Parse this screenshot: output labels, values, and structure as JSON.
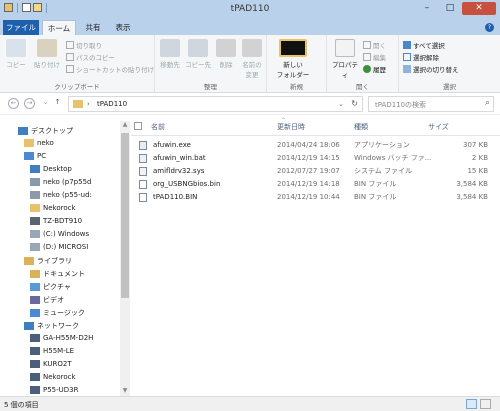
{
  "window": {
    "title": "tPAD110",
    "minimize": "–",
    "maximize": "□",
    "close": "✕"
  },
  "ribbon_tabs": [
    {
      "label": "ファイル"
    },
    {
      "label": "ホーム"
    },
    {
      "label": "共有"
    },
    {
      "label": "表示"
    }
  ],
  "help": "?",
  "ribbon": {
    "clipboard": {
      "copy": "コピー",
      "paste": "貼り付け",
      "cut": "切り取り",
      "copy_path": "パスのコピー",
      "paste_shortcut": "ショートカットの貼り付け",
      "group": "クリップボード"
    },
    "organize": {
      "move_to": "移動先",
      "copy_to": "コピー先",
      "delete": "削除",
      "rename_1": "名前の",
      "rename_2": "変更",
      "group": "整理"
    },
    "new": {
      "new_folder_1": "新しい",
      "new_folder_2": "フォルダー",
      "group": "新規"
    },
    "open": {
      "properties": "プロパティ",
      "open": "開く",
      "edit": "編集",
      "history": "履歴",
      "group": "開く"
    },
    "select": {
      "select_all": "すべて選択",
      "select_none": "選択解除",
      "invert": "選択の切り替え",
      "group": "選択"
    }
  },
  "address": {
    "sep": "›",
    "path": "tPAD110",
    "dropdown": "⌄",
    "refresh": "↻"
  },
  "search": {
    "placeholder": "tPAD110の検索",
    "icon": "⌕"
  },
  "nav": {
    "back": "←",
    "forward": "→",
    "recent": "⌄",
    "up": "↑",
    "items": [
      {
        "label": "デスクトップ",
        "icon": "desktop-icon"
      },
      {
        "label": "neko",
        "icon": "user-folder-icon"
      },
      {
        "label": "PC",
        "icon": "pc-icon"
      },
      {
        "label": "Desktop",
        "icon": "folder-icon"
      },
      {
        "label": "neko (p7p55d",
        "icon": "network-drive-icon"
      },
      {
        "label": "neko (p55-ud:",
        "icon": "network-drive-icon"
      },
      {
        "label": "Nekorock",
        "icon": "folder-icon"
      },
      {
        "label": "TZ-BDT910",
        "icon": "device-icon"
      },
      {
        "label": "(C:) Windows",
        "icon": "drive-icon"
      },
      {
        "label": "(D:) MICROSI",
        "icon": "drive-icon"
      },
      {
        "label": "ライブラリ",
        "icon": "library-icon"
      },
      {
        "label": "ドキュメント",
        "icon": "documents-icon"
      },
      {
        "label": "ピクチャ",
        "icon": "pictures-icon"
      },
      {
        "label": "ビデオ",
        "icon": "videos-icon"
      },
      {
        "label": "ミュージック",
        "icon": "music-icon"
      },
      {
        "label": "ネットワーク",
        "icon": "network-icon"
      },
      {
        "label": "GA-H55M-D2H",
        "icon": "computer-icon"
      },
      {
        "label": "H55M-LE",
        "icon": "computer-icon"
      },
      {
        "label": "KURO2T",
        "icon": "computer-icon"
      },
      {
        "label": "Nekorock",
        "icon": "computer-icon"
      },
      {
        "label": "P55-UD3R",
        "icon": "computer-icon"
      }
    ]
  },
  "columns": {
    "name": "名前",
    "modified": "更新日時",
    "type": "種類",
    "size": "サイズ",
    "sort_arrow": "⌃"
  },
  "files": [
    {
      "name": "afuwin.exe",
      "modified": "2014/04/24 18:06",
      "type": "アプリケーション",
      "size": "307 KB",
      "icon": "exe-icon"
    },
    {
      "name": "afuwin_win.bat",
      "modified": "2014/12/19 14:15",
      "type": "Windows バッチ ファ...",
      "size": "2 KB",
      "icon": "bat-icon"
    },
    {
      "name": "amifldrv32.sys",
      "modified": "2012/07/27 19:07",
      "type": "システム ファイル",
      "size": "15 KB",
      "icon": "sys-icon"
    },
    {
      "name": "org_USBNGbios.bin",
      "modified": "2014/12/19 14:18",
      "type": "BIN ファイル",
      "size": "3,584 KB",
      "icon": "bin-icon"
    },
    {
      "name": "tPAD110.BIN",
      "modified": "2014/12/19 10:44",
      "type": "BIN ファイル",
      "size": "3,584 KB",
      "icon": "bin-icon"
    }
  ],
  "status": {
    "item_count": "5 個の項目"
  },
  "colors": {
    "accent": "#1e5fae",
    "titlebar": "#b9d1ea",
    "close": "#c7503f",
    "folder": "#e8c26a"
  }
}
